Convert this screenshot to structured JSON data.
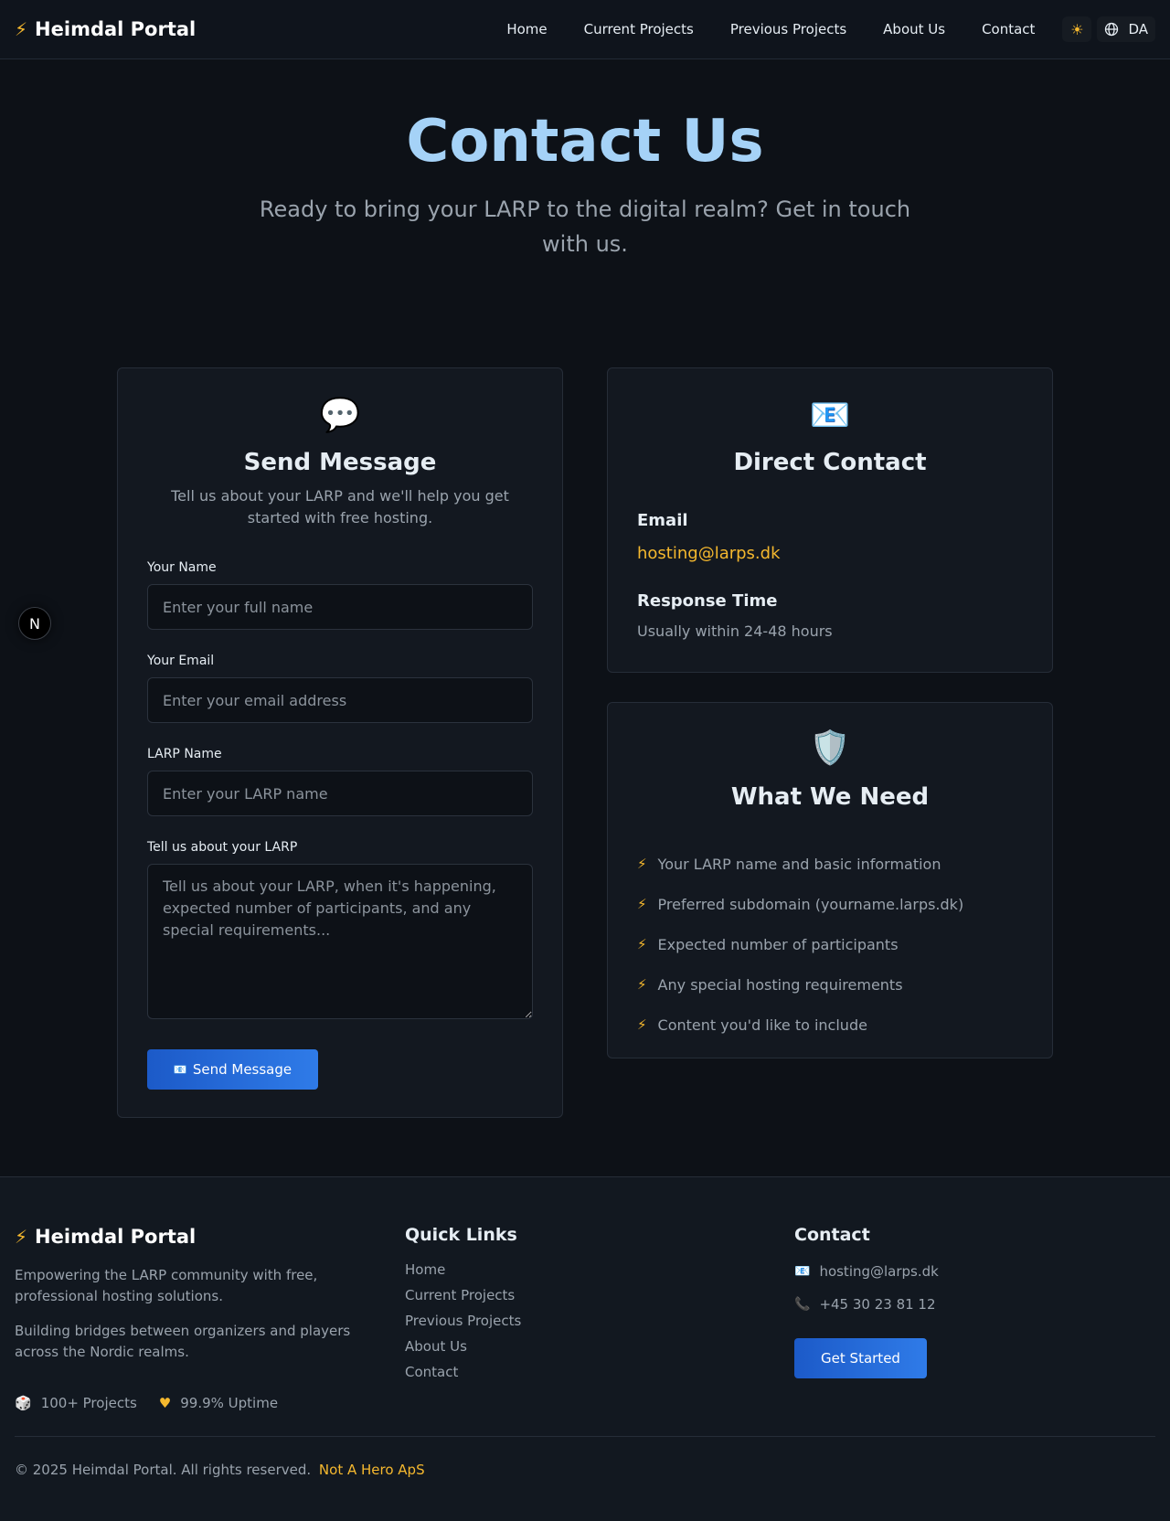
{
  "nav": {
    "brand": "Heimdal Portal",
    "links": [
      "Home",
      "Current Projects",
      "Previous Projects",
      "About Us",
      "Contact"
    ],
    "language": "DA"
  },
  "hero": {
    "title": "Contact Us",
    "subtitle": "Ready to bring your LARP to the digital realm? Get in touch with us."
  },
  "form_card": {
    "title": "Send Message",
    "description": "Tell us about your LARP and we'll help you get started with free hosting.",
    "fields": [
      {
        "label": "Your Name",
        "placeholder": "Enter your full name"
      },
      {
        "label": "Your Email",
        "placeholder": "Enter your email address"
      },
      {
        "label": "LARP Name",
        "placeholder": "Enter your LARP name"
      },
      {
        "label": "Tell us about your LARP",
        "placeholder": "Tell us about your LARP, when it's happening, expected number of participants, and any special requirements..."
      }
    ],
    "submit_label": "Send Message"
  },
  "direct_contact": {
    "title": "Direct Contact",
    "email_heading": "Email",
    "email": "hosting@larps.dk",
    "response_heading": "Response Time",
    "response_text": "Usually within 24-48 hours"
  },
  "needs_card": {
    "title": "What We Need",
    "items": [
      "Your LARP name and basic information",
      "Preferred subdomain (yourname.larps.dk)",
      "Expected number of participants",
      "Any special hosting requirements",
      "Content you'd like to include"
    ]
  },
  "side_badge": "N",
  "footer": {
    "brand": "Heimdal Portal",
    "tagline": "Empowering the LARP community with free, professional hosting solutions.",
    "mission": "Building bridges between organizers and players across the Nordic realms.",
    "stats": [
      "100+ Projects",
      "99.9% Uptime"
    ],
    "quick_links_title": "Quick Links",
    "quick_links": [
      "Home",
      "Current Projects",
      "Previous Projects",
      "About Us",
      "Contact"
    ],
    "contact_title": "Contact",
    "contact_email": "hosting@larps.dk",
    "contact_phone": "+45 30 23 81 12",
    "cta_label": "Get Started",
    "copyright": "© 2025 Heimdal Portal. All rights reserved.",
    "company": "Not A Hero ApS"
  },
  "colors": {
    "accent": "#f5b82e",
    "primary_button": "#2563d8",
    "hero_title": "#a5d2f7",
    "background": "#0d1117"
  },
  "icons": {
    "brand": "lightning-bolt-icon",
    "theme": "sun-icon",
    "language": "globe-icon",
    "form_card": "speech-bubble-icon",
    "contact_card": "envelope-icon",
    "needs_card": "shield-icon",
    "stats": [
      "dice-icon",
      "heart-icon"
    ],
    "footer_contact": [
      "envelope-icon",
      "phone-icon"
    ]
  }
}
